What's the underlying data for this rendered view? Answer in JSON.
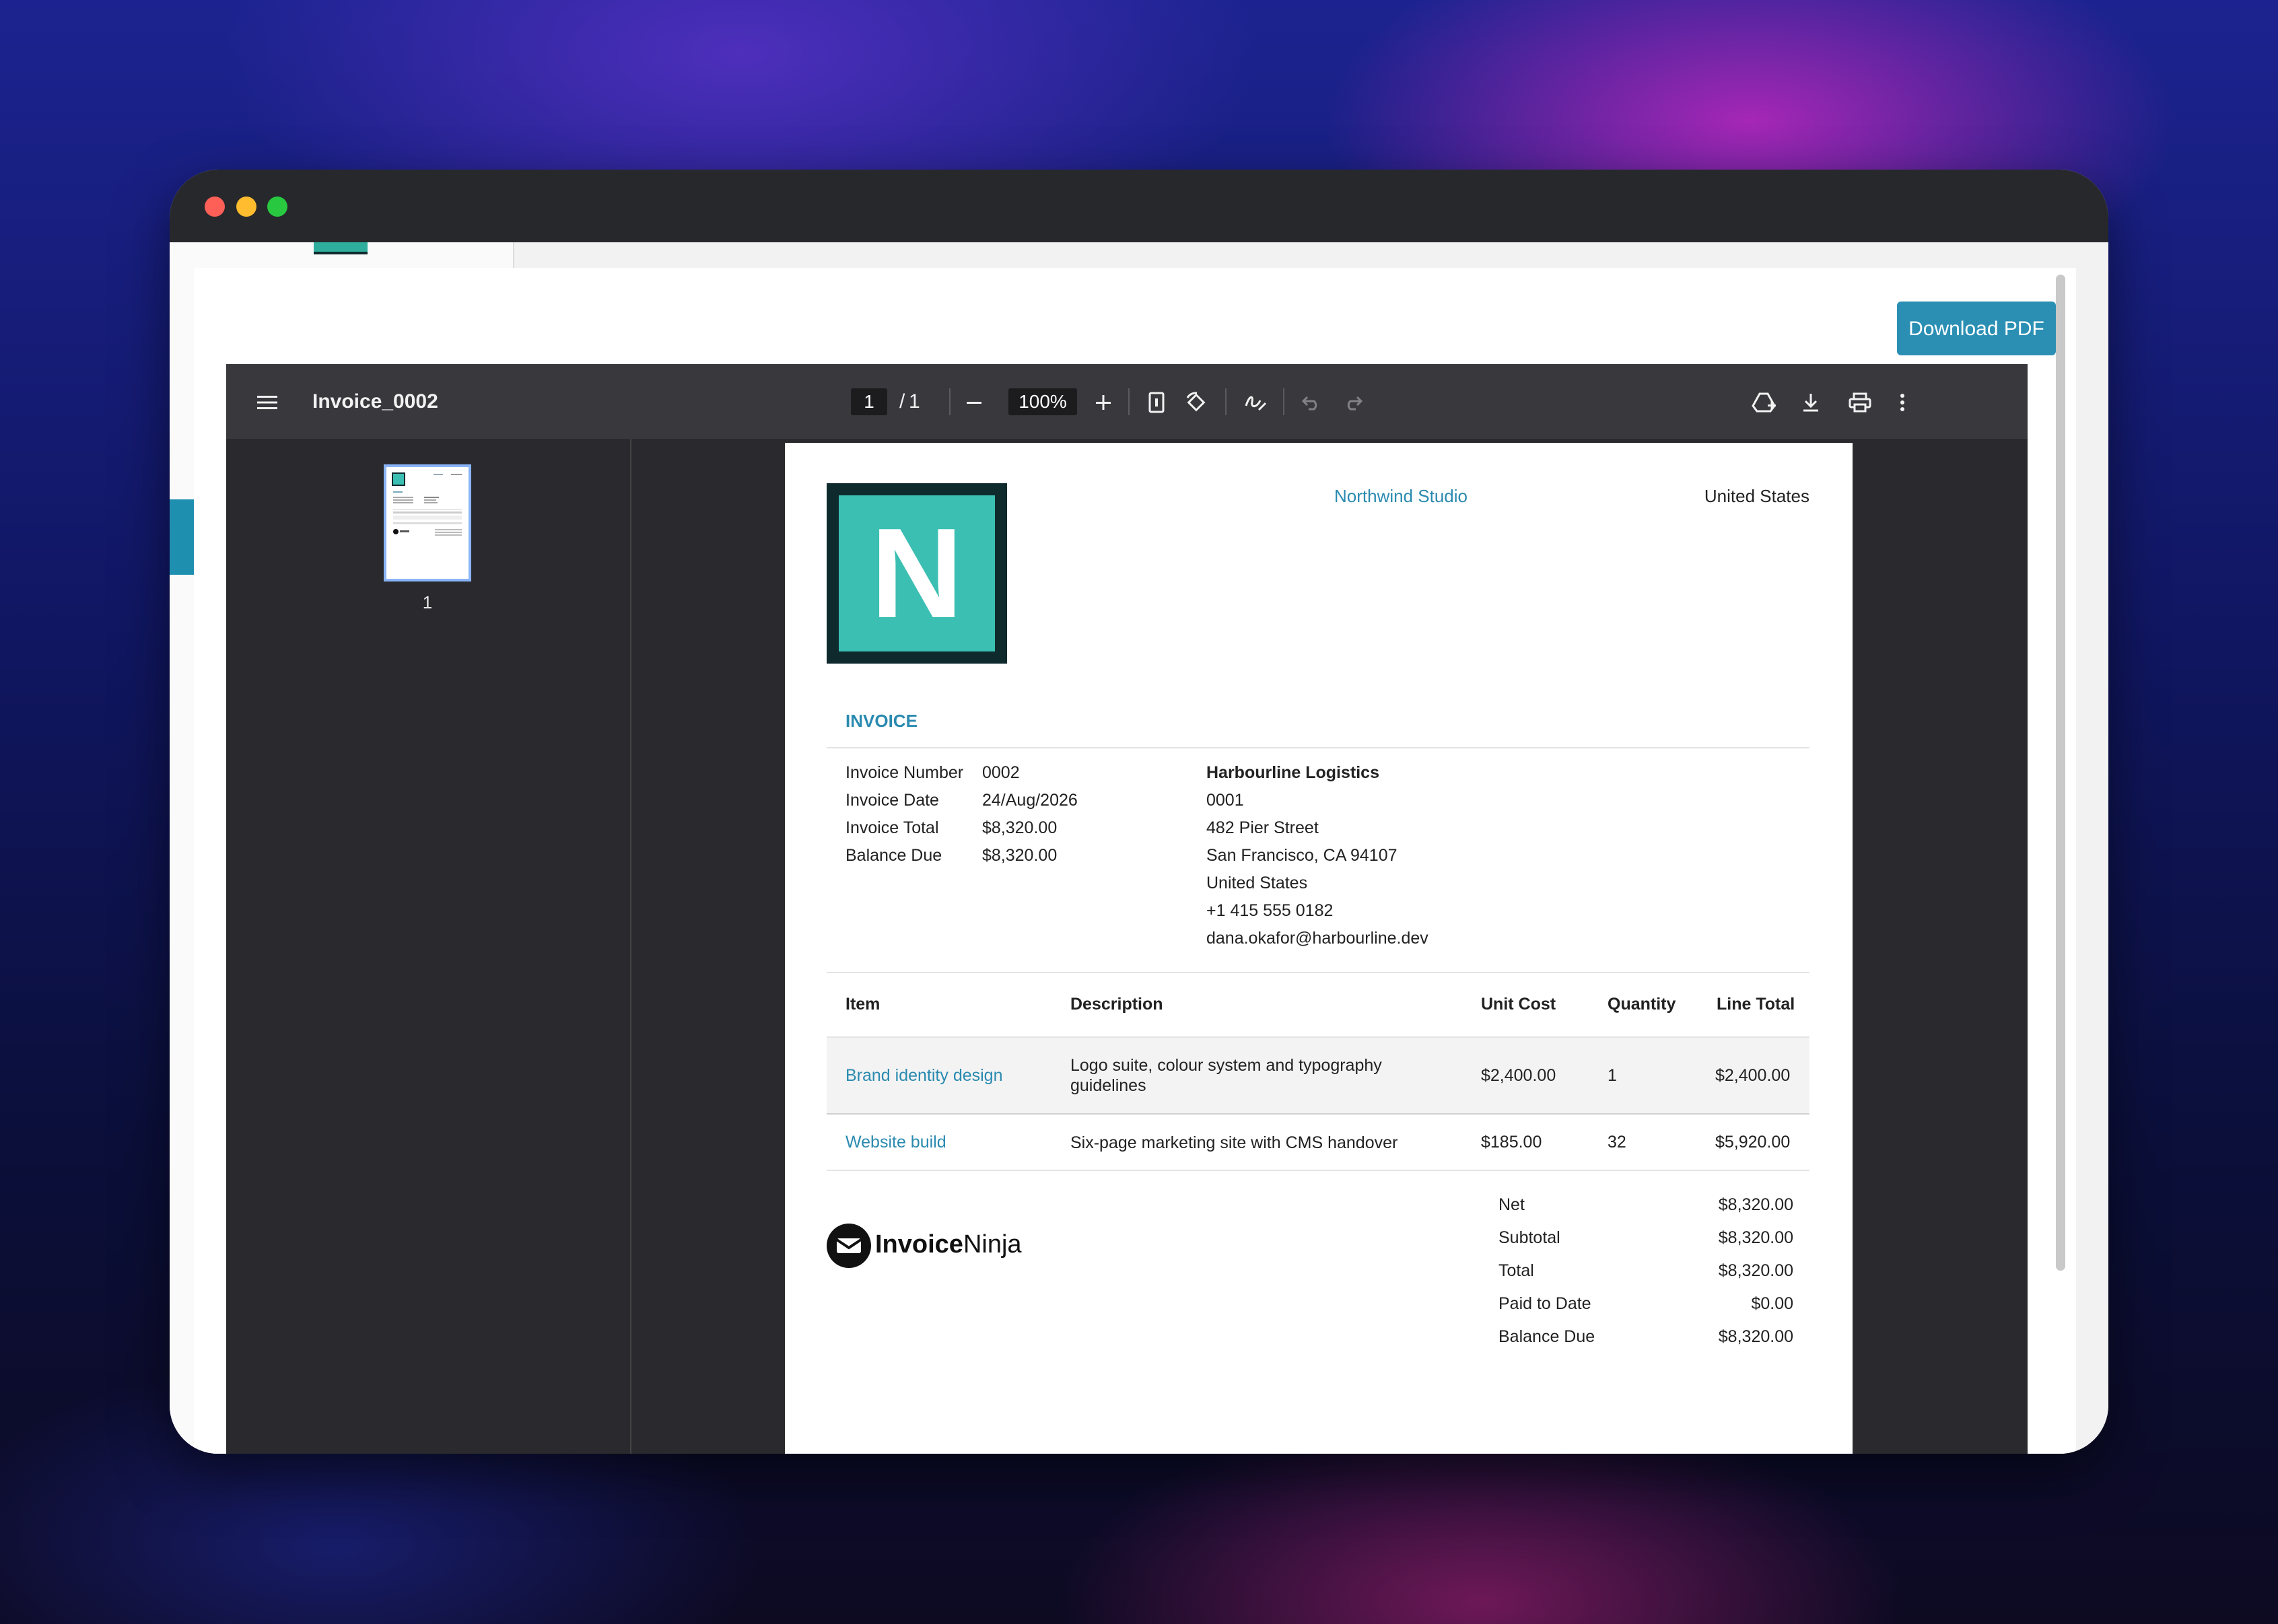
{
  "window": {
    "controls": [
      "close",
      "minimize",
      "maximize"
    ]
  },
  "modal": {
    "download_label": "Download PDF",
    "close_label": "✕"
  },
  "viewer": {
    "doc_title": "Invoice_0002",
    "current_page": "1",
    "page_separator": "/",
    "page_count": "1",
    "zoom": "100%",
    "thumbnail_label": "1"
  },
  "invoice": {
    "logo_letter": "N",
    "company_name": "Northwind Studio",
    "company_country": "United States",
    "heading": "INVOICE",
    "details": [
      {
        "label": "Invoice Number",
        "value": "0002"
      },
      {
        "label": "Invoice Date",
        "value": "24/Aug/2026"
      },
      {
        "label": "Invoice Total",
        "value": "$8,320.00"
      },
      {
        "label": "Balance Due",
        "value": "$8,320.00"
      }
    ],
    "client": {
      "name": "Harbourline Logistics",
      "number": "0001",
      "street": "482 Pier Street",
      "city": "San Francisco, CA 94107",
      "country": "United States",
      "phone": "+1 415 555 0182",
      "email": "dana.okafor@harbourline.dev"
    },
    "columns": [
      "Item",
      "Description",
      "Unit Cost",
      "Quantity",
      "Line Total"
    ],
    "items": [
      {
        "item": "Brand identity design",
        "description": "Logo suite, colour system and typography guidelines",
        "unit_cost": "$2,400.00",
        "quantity": "1",
        "line_total": "$2,400.00"
      },
      {
        "item": "Website build",
        "description": "Six-page marketing site with CMS handover",
        "unit_cost": "$185.00",
        "quantity": "32",
        "line_total": "$5,920.00"
      }
    ],
    "totals": [
      {
        "label": "Net",
        "value": "$8,320.00"
      },
      {
        "label": "Subtotal",
        "value": "$8,320.00"
      },
      {
        "label": "Total",
        "value": "$8,320.00"
      },
      {
        "label": "Paid to Date",
        "value": "$0.00"
      },
      {
        "label": "Balance Due",
        "value": "$8,320.00"
      }
    ],
    "brand_bold": "Invoice",
    "brand_light": "Ninja"
  },
  "colors": {
    "accent": "#2b8fb4",
    "logo_teal": "#3cbfb3",
    "logo_border": "#0f2a2d",
    "toolbar": "#38383d"
  }
}
